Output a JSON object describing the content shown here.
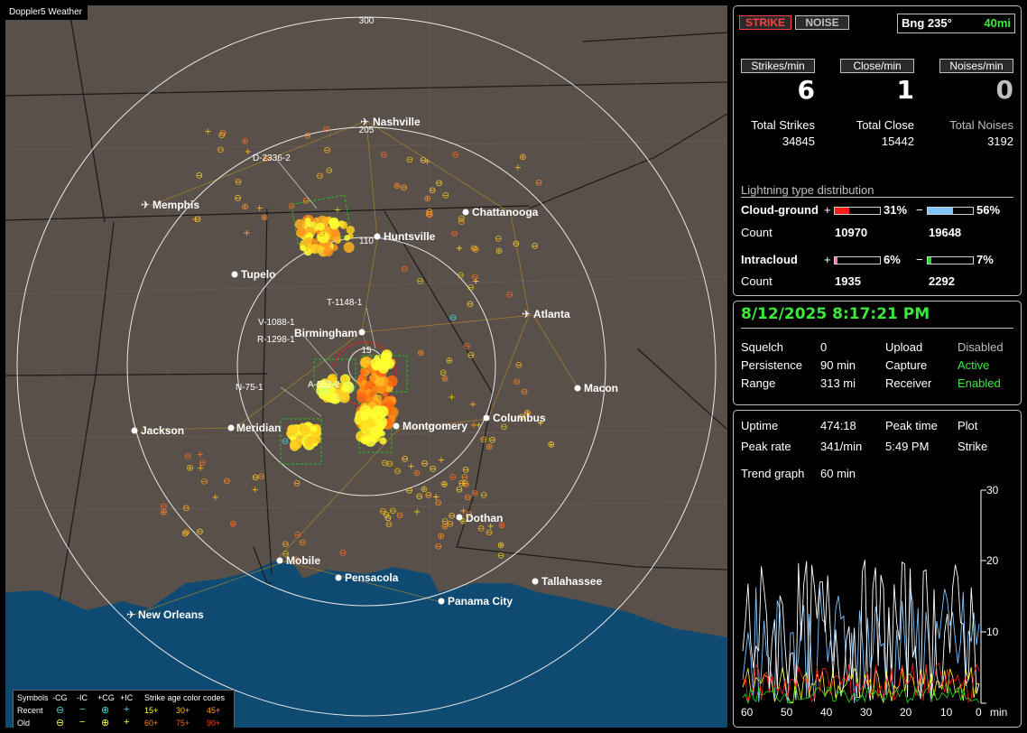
{
  "app": {
    "title": "Doppler5 Weather"
  },
  "toolbar": {
    "strike_label": "STRIKE",
    "noise_label": "NOISE",
    "bearing": "Bng 235°",
    "range": "40mi"
  },
  "rates": {
    "strikes_label": "Strikes/min",
    "strikes_value": "6",
    "close_label": "Close/min",
    "close_value": "1",
    "noises_label": "Noises/min",
    "noises_value": "0"
  },
  "totals": {
    "strikes_label": "Total Strikes",
    "strikes_value": "34845",
    "close_label": "Total Close",
    "close_value": "15442",
    "noises_label": "Total Noises",
    "noises_value": "3192"
  },
  "distribution": {
    "title": "Lightning type distribution",
    "cg_label": "Cloud-ground",
    "count_label": "Count",
    "ic_label": "Intracloud",
    "plus": "+",
    "minus": "−",
    "cg_pos_pct": "31%",
    "cg_pos_frac": 0.31,
    "cg_neg_pct": "56%",
    "cg_neg_frac": 0.56,
    "cg_pos_count": "10970",
    "cg_neg_count": "19648",
    "ic_pos_pct": "6%",
    "ic_pos_frac": 0.06,
    "ic_neg_pct": "7%",
    "ic_neg_frac": 0.07,
    "ic_pos_count": "1935",
    "ic_neg_count": "2292",
    "colors": {
      "cg_pos": "#ff1a1a",
      "cg_neg": "#7fc4ff",
      "ic_pos": "#ff6fc0",
      "ic_neg": "#22dd22"
    }
  },
  "status": {
    "datetime": "8/12/2025 8:17:21 PM",
    "squelch_label": "Squelch",
    "squelch_value": "0",
    "persistence_label": "Persistence",
    "persistence_value": "90 min",
    "range_label": "Range",
    "range_value": "313 mi",
    "upload_label": "Upload",
    "upload_value": "Disabled",
    "capture_label": "Capture",
    "capture_value": "Active",
    "receiver_label": "Receiver",
    "receiver_value": "Enabled"
  },
  "trend": {
    "uptime_label": "Uptime",
    "uptime_value": "474:18",
    "peak_time_label": "Peak time",
    "peak_time_value": "5:49 PM",
    "plot_label": "Plot",
    "plot_value": "Strike",
    "peak_rate_label": "Peak rate",
    "peak_rate_value": "341/min",
    "trend_graph_label": "Trend graph",
    "trend_graph_value": "60 min",
    "y_ticks": [
      "30",
      "20",
      "10"
    ],
    "x_ticks": [
      "60",
      "50",
      "40",
      "30",
      "20",
      "10",
      "0"
    ],
    "x_unit": "min"
  },
  "map": {
    "range_rings": [
      "300",
      "205",
      "110",
      "15"
    ],
    "cities": [
      "Nashville",
      "Memphis",
      "Chattanooga",
      "Huntsville",
      "Tupelo",
      "Atlanta",
      "Birmingham",
      "Macon",
      "Jackson",
      "Meridian",
      "Montgomery",
      "Columbus",
      "Dothan",
      "Mobile",
      "Pensacola",
      "Tallahassee",
      "Panama City",
      "New Orleans"
    ],
    "storm_labels": [
      "D-2336-2",
      "T-1148-1",
      "V-1088-1",
      "R-1298-1",
      "N-75-1",
      "A-552-2"
    ]
  },
  "legend": {
    "symbols_label": "Symbols",
    "neg_cg": "-CG",
    "neg_ic": "-IC",
    "pos_cg": "+CG",
    "pos_ic": "+IC",
    "age_label": "Strike age color codes",
    "recent_label": "Recent",
    "old_label": "Old",
    "recent_ages": [
      "15+",
      "30+",
      "45+"
    ],
    "old_ages": [
      "60+",
      "75+",
      "90+"
    ]
  }
}
